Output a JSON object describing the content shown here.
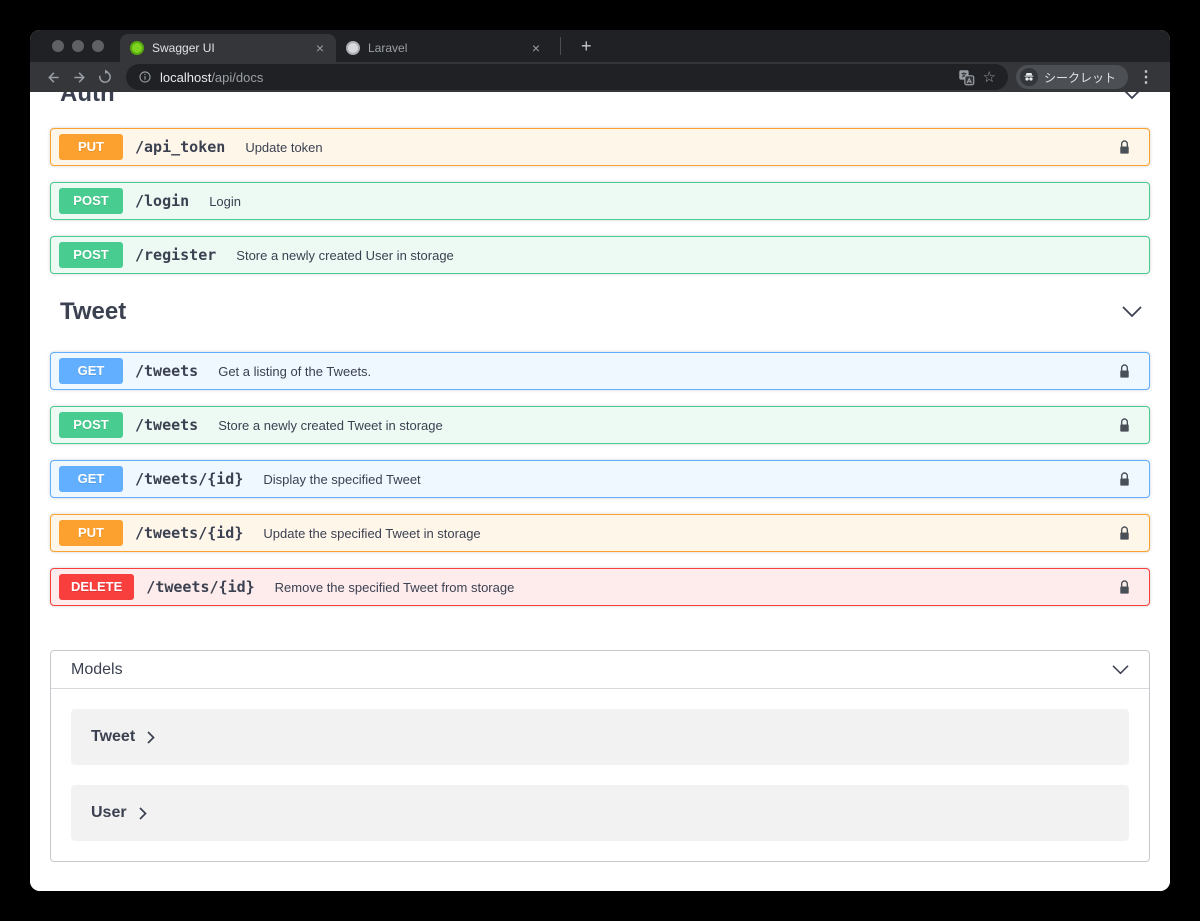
{
  "browser": {
    "tabs": [
      {
        "label": "Swagger UI",
        "active": true
      },
      {
        "label": "Laravel",
        "active": false
      }
    ],
    "address": {
      "host": "localhost",
      "path": "/api/docs"
    },
    "profile_label": "シークレット"
  },
  "icons": {
    "tab_close": "×",
    "new_tab": "+",
    "bookmark_star": "☆",
    "overflow_menu": "⋮"
  },
  "api": {
    "sections": [
      {
        "title": "Auth",
        "operations": [
          {
            "method": "PUT",
            "path": "/api_token",
            "description": "Update token",
            "auth": true
          },
          {
            "method": "POST",
            "path": "/login",
            "description": "Login",
            "auth": false
          },
          {
            "method": "POST",
            "path": "/register",
            "description": "Store a newly created User in storage",
            "auth": false
          }
        ]
      },
      {
        "title": "Tweet",
        "operations": [
          {
            "method": "GET",
            "path": "/tweets",
            "description": "Get a listing of the Tweets.",
            "auth": true
          },
          {
            "method": "POST",
            "path": "/tweets",
            "description": "Store a newly created Tweet in storage",
            "auth": true
          },
          {
            "method": "GET",
            "path": "/tweets/{id}",
            "description": "Display the specified Tweet",
            "auth": true
          },
          {
            "method": "PUT",
            "path": "/tweets/{id}",
            "description": "Update the specified Tweet in storage",
            "auth": true
          },
          {
            "method": "DELETE",
            "path": "/tweets/{id}",
            "description": "Remove the specified Tweet from storage",
            "auth": true
          }
        ]
      }
    ],
    "models": {
      "title": "Models",
      "items": [
        {
          "name": "Tweet"
        },
        {
          "name": "User"
        }
      ]
    },
    "method_colors": {
      "GET": "#61affe",
      "POST": "#49cc90",
      "PUT": "#fca130",
      "DELETE": "#f93e3e"
    }
  }
}
